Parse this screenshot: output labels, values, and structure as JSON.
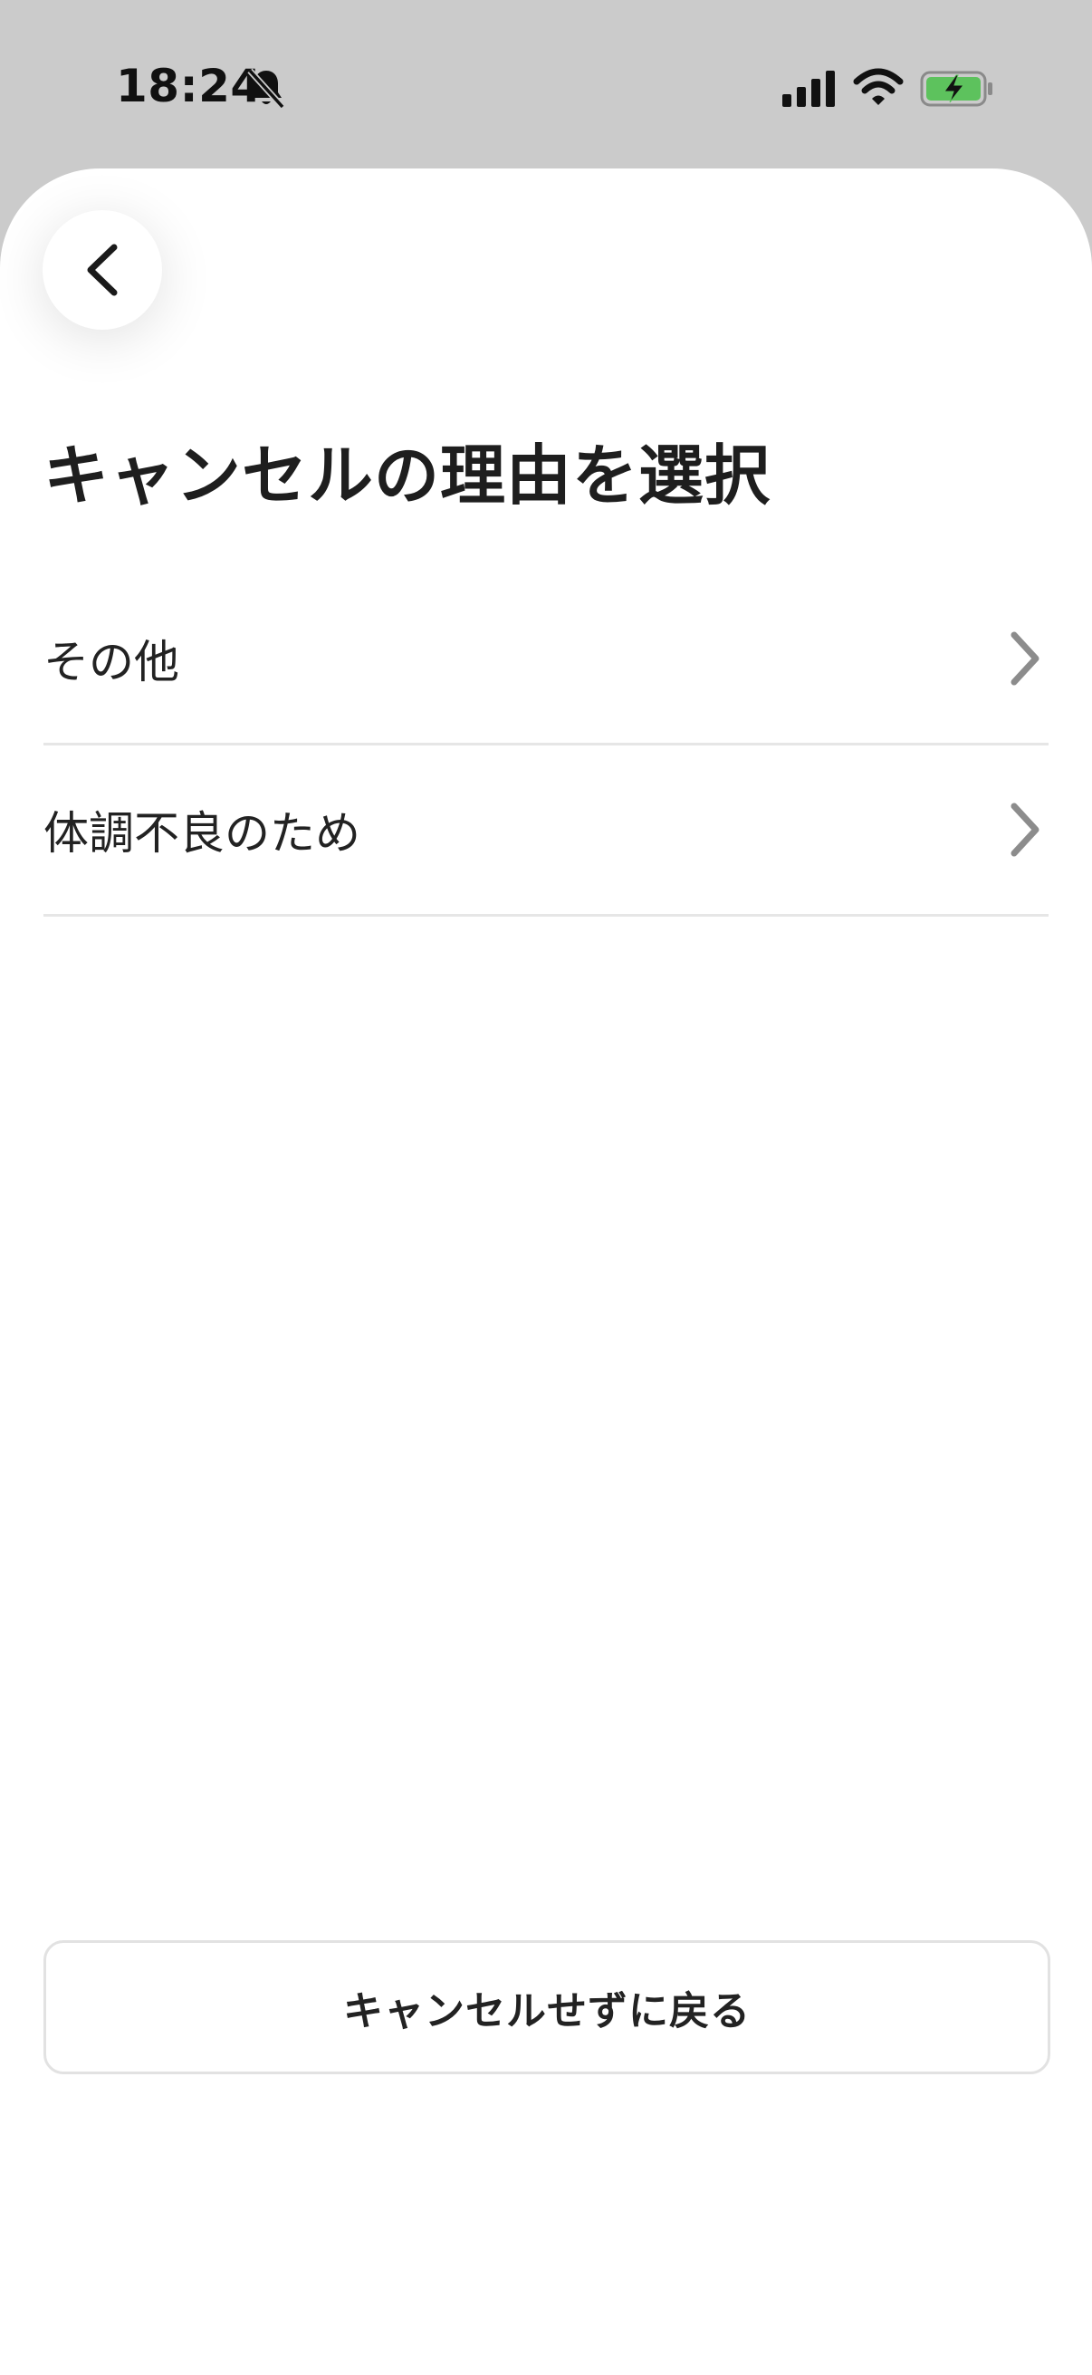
{
  "status_bar": {
    "time": "18:24",
    "icons": [
      "bell-slash-icon",
      "cellular-signal-icon",
      "wifi-icon",
      "battery-charging-icon"
    ],
    "battery_color": "#5dc25d"
  },
  "header": {
    "back_icon": "chevron-left-icon",
    "title": "キャンセルの理由を選択"
  },
  "reasons": [
    {
      "label": "その他"
    },
    {
      "label": "体調不良のため"
    }
  ],
  "footer": {
    "keep_label": "キャンセルせずに戻る"
  }
}
